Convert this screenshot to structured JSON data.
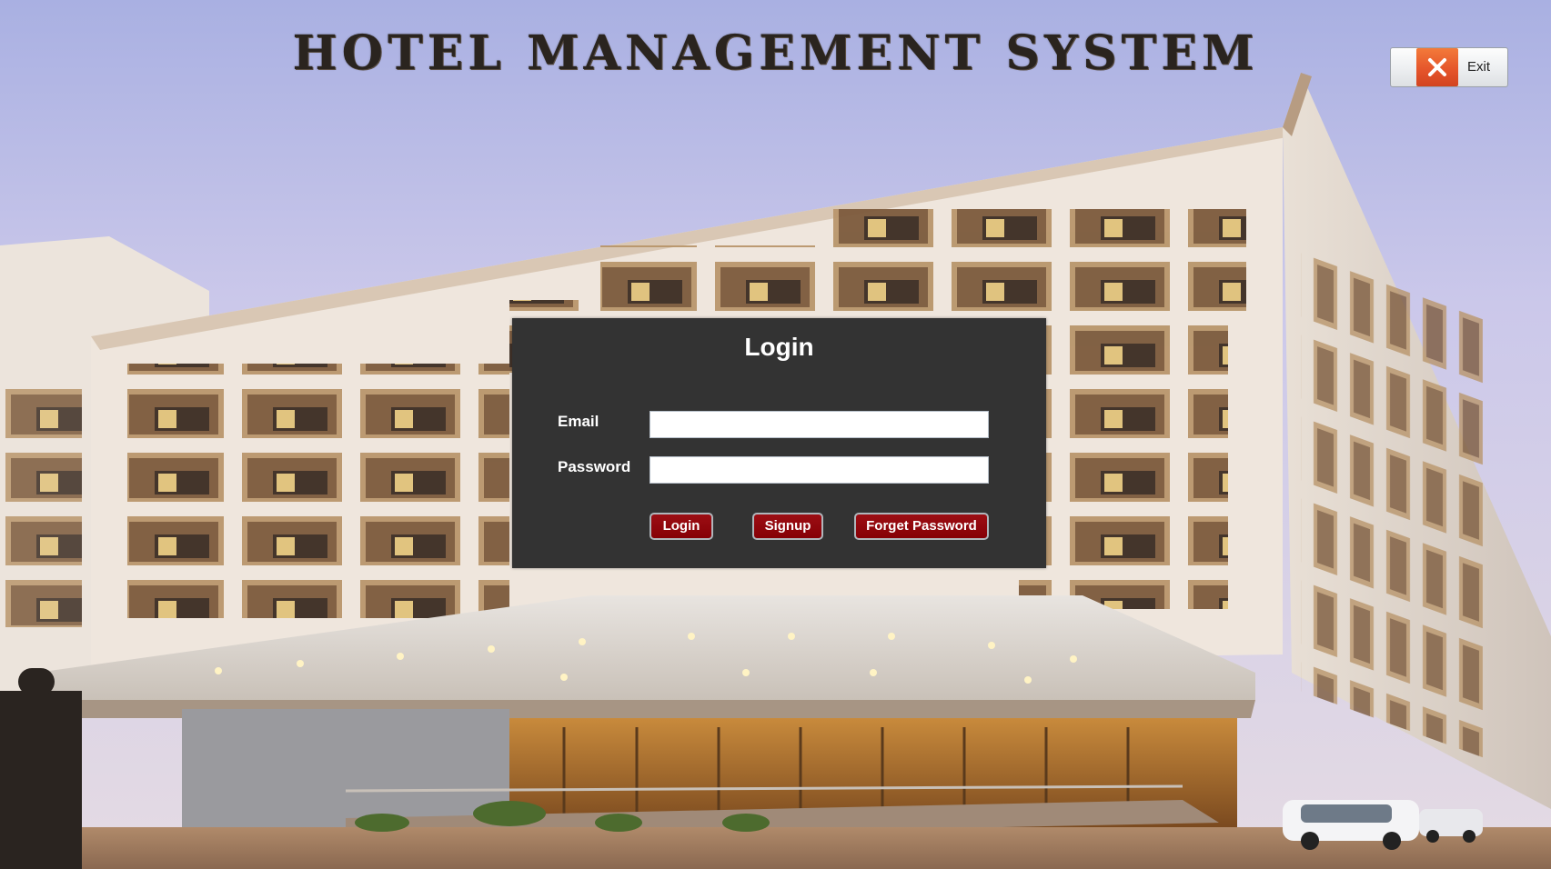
{
  "app": {
    "title": "HOTEL MANAGEMENT SYSTEM"
  },
  "window": {
    "exit_label": "Exit",
    "exit_icon": "close-x-icon"
  },
  "login": {
    "title": "Login",
    "email_label": "Email",
    "email_value": "",
    "password_label": "Password",
    "password_value": "",
    "buttons": {
      "login": "Login",
      "signup": "Signup",
      "forget_password": "Forget Password"
    }
  },
  "colors": {
    "panel_background": "#333333",
    "button_background": "#8b0a0e",
    "exit_icon_background": "#e4532a",
    "title_color": "#2a241f"
  }
}
